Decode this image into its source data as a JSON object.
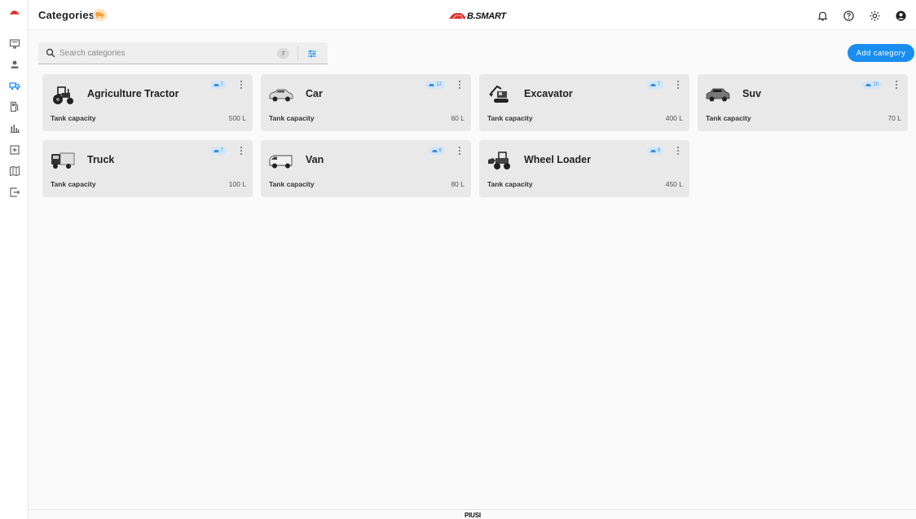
{
  "header": {
    "title": "Categories",
    "brand": "B.SMART"
  },
  "search": {
    "placeholder": "Search categories",
    "value": "",
    "count": "7"
  },
  "actions": {
    "add_label": "Add category"
  },
  "colors": {
    "accent": "#1a8ef0",
    "brand_red": "#e02f2f",
    "badge_orange": "#f5a237",
    "card_bg": "#e9e9e9",
    "chip_bg": "#d2e6fa"
  },
  "sidebar": {
    "items": [
      {
        "icon": "logo-icon"
      },
      {
        "icon": "monitor-icon"
      },
      {
        "icon": "person-icon"
      },
      {
        "icon": "vehicle-categories-icon",
        "active": true
      },
      {
        "icon": "fuel-pump-icon"
      },
      {
        "icon": "bar-chart-icon"
      },
      {
        "icon": "add-box-icon"
      },
      {
        "icon": "map-icon"
      },
      {
        "icon": "logout-icon"
      }
    ]
  },
  "categories": [
    {
      "name": "Agriculture Tractor",
      "vehicles": "7",
      "tank_label": "Tank capacity",
      "tank_value": "500 L",
      "icon": "tractor-icon"
    },
    {
      "name": "Car",
      "vehicles": "12",
      "tank_label": "Tank capacity",
      "tank_value": "60 L",
      "icon": "car-icon"
    },
    {
      "name": "Excavator",
      "vehicles": "7",
      "tank_label": "Tank capacity",
      "tank_value": "400 L",
      "icon": "excavator-icon"
    },
    {
      "name": "Suv",
      "vehicles": "10",
      "tank_label": "Tank capacity",
      "tank_value": "70 L",
      "icon": "suv-icon"
    },
    {
      "name": "Truck",
      "vehicles": "7",
      "tank_label": "Tank capacity",
      "tank_value": "100 L",
      "icon": "truck-icon"
    },
    {
      "name": "Van",
      "vehicles": "6",
      "tank_label": "Tank capacity",
      "tank_value": "80 L",
      "icon": "van-icon"
    },
    {
      "name": "Wheel Loader",
      "vehicles": "9",
      "tank_label": "Tank capacity",
      "tank_value": "450 L",
      "icon": "wheel-loader-icon"
    }
  ],
  "footer": {
    "logo": "PIUSI"
  }
}
